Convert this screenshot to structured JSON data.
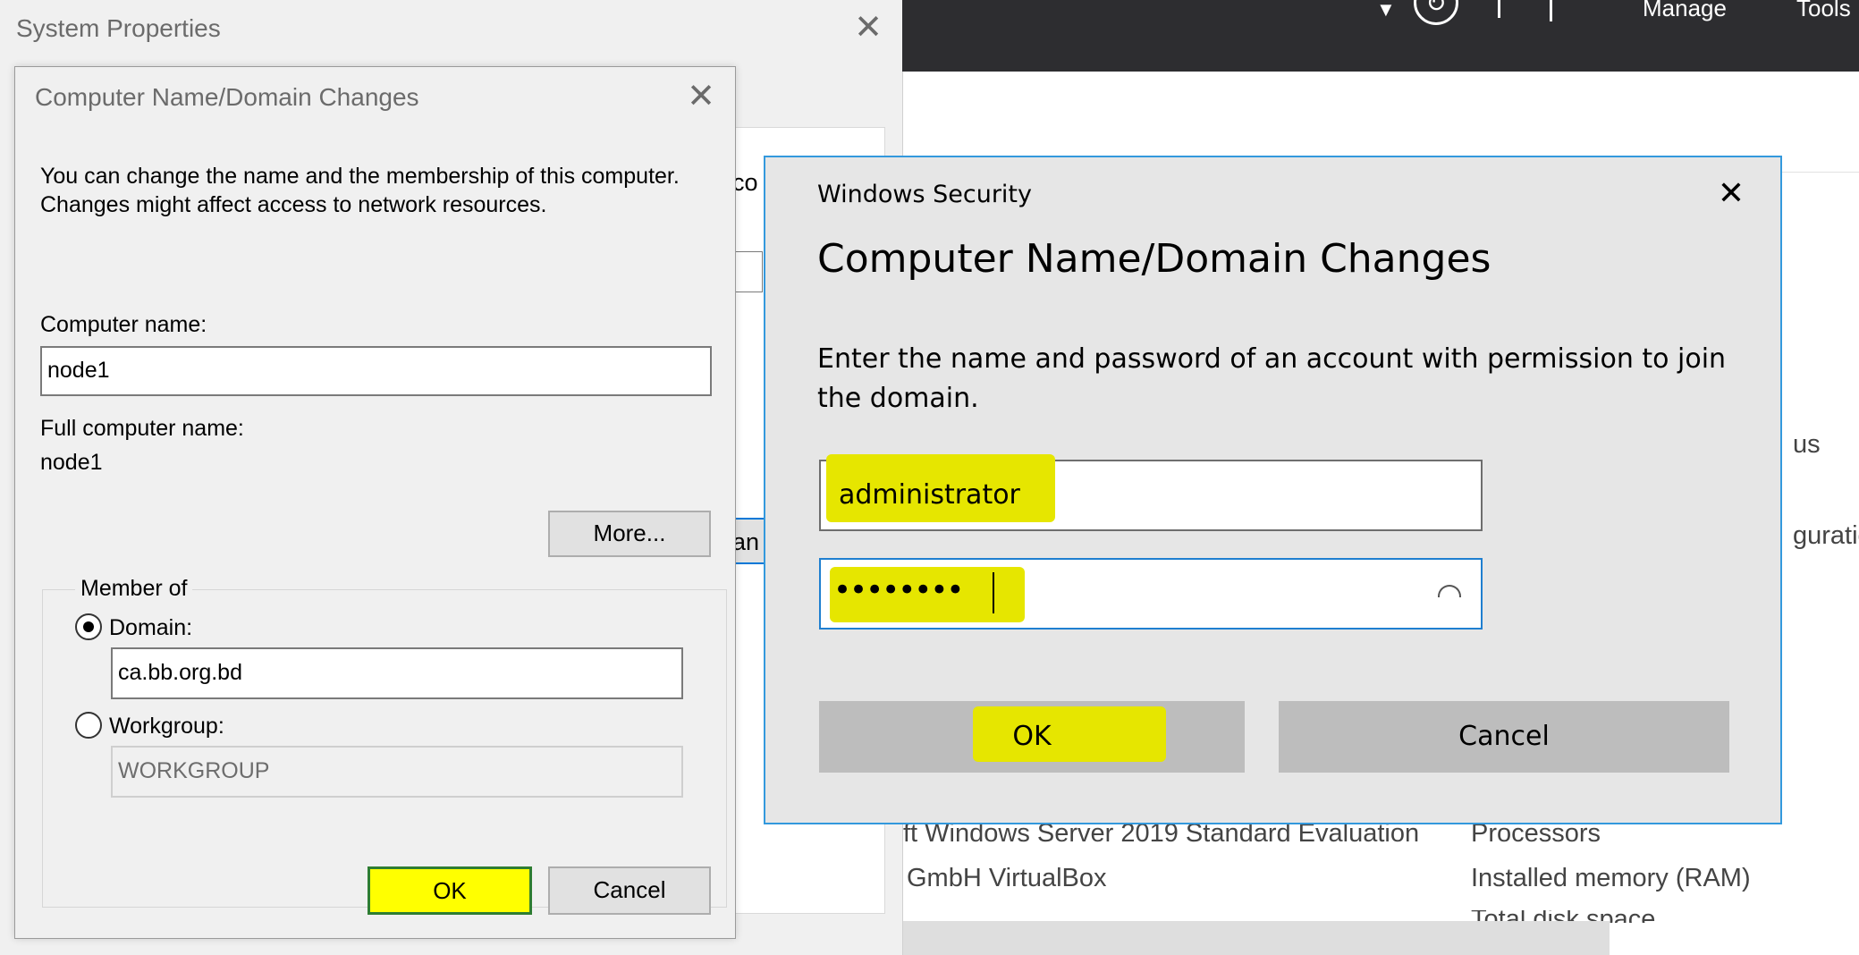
{
  "server_manager": {
    "menu_manage": "Manage",
    "menu_tools": "Tools",
    "partial_status": "us",
    "partial_config": "guratio",
    "os_line": "ft Windows Server 2019 Standard Evaluation",
    "maker_line": "GmbH VirtualBox",
    "label_processors": "Processors",
    "label_memory": "Installed memory (RAM)",
    "label_disk": "Total disk space"
  },
  "system_properties": {
    "title": "System Properties",
    "partial_text_1": "co",
    "partial_text_2": "an"
  },
  "cnd_dialog": {
    "title": "Computer Name/Domain Changes",
    "description": "You can change the name and the membership of this computer. Changes might affect access to network resources.",
    "computer_name_label": "Computer name:",
    "computer_name_value": "node1",
    "full_name_label": "Full computer name:",
    "full_name_value": "node1",
    "more_button": "More...",
    "member_of_label": "Member of",
    "domain_label": "Domain:",
    "domain_value": "ca.bb.org.bd",
    "workgroup_label": "Workgroup:",
    "workgroup_value": "WORKGROUP",
    "ok_button": "OK",
    "cancel_button": "Cancel",
    "selected_membership": "Domain"
  },
  "windows_security": {
    "title": "Windows Security",
    "heading": "Computer Name/Domain Changes",
    "description": "Enter the name and password of an account with permission to join the domain.",
    "username_value": "administrator",
    "password_value": "••••••••",
    "ok_button": "OK",
    "cancel_button": "Cancel"
  },
  "colors": {
    "highlight": "#e6e600",
    "dialog_border": "#3399dd",
    "titlebar_dark": "#2d2d30"
  },
  "icons": [
    "close-icon",
    "refresh-icon",
    "reveal-password-icon",
    "dropdown-arrow-icon"
  ]
}
